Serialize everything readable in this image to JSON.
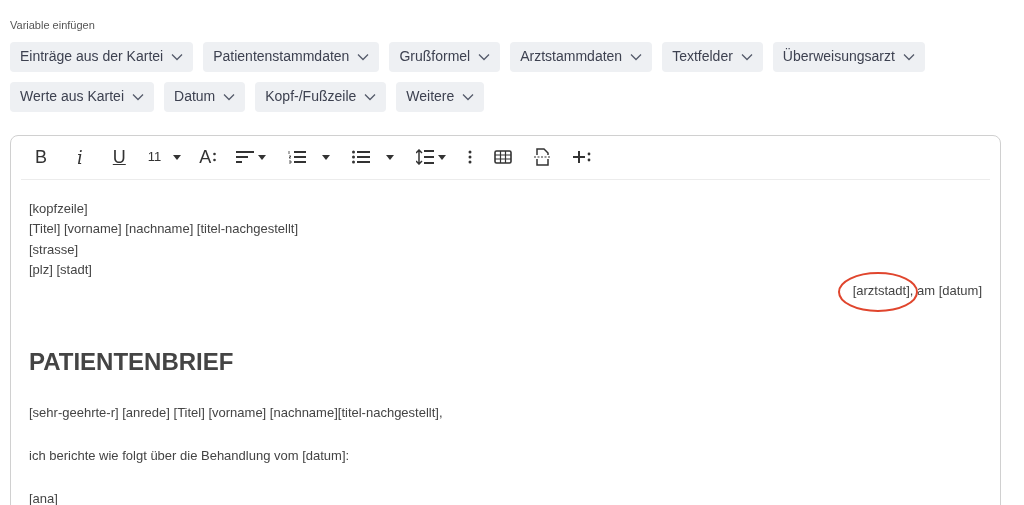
{
  "variables": {
    "label": "Variable einfügen",
    "buttons": [
      "Einträge aus der Kartei",
      "Patientenstammdaten",
      "Grußformel",
      "Arztstammdaten",
      "Textfelder",
      "Überweisungsarzt",
      "Werte aus Kartei",
      "Datum",
      "Kopf-/Fußzeile",
      "Weitere"
    ]
  },
  "toolbar": [
    {
      "kind": "bold",
      "label": "B"
    },
    {
      "kind": "italic",
      "label": "i"
    },
    {
      "kind": "underline",
      "label": "U"
    },
    {
      "kind": "fontsize",
      "label": "11"
    },
    {
      "kind": "format",
      "label": "A"
    },
    {
      "kind": "align"
    },
    {
      "kind": "numbered"
    },
    {
      "kind": "bullets"
    },
    {
      "kind": "lineheight"
    },
    {
      "kind": "more"
    },
    {
      "kind": "table"
    },
    {
      "kind": "pagebreak"
    },
    {
      "kind": "insert"
    }
  ],
  "document": [
    {
      "kind": "line",
      "text": "[kopfzeile]"
    },
    {
      "kind": "line",
      "text": "[Titel] [vorname] [nachname] [titel-nachgestellt]"
    },
    {
      "kind": "line",
      "text": "[strasse]"
    },
    {
      "kind": "line",
      "text": "[plz] [stadt]"
    },
    {
      "kind": "right",
      "text": "[arztstadt], am [datum]"
    },
    {
      "kind": "heading",
      "text": "PATIENTENBRIEF"
    },
    {
      "kind": "paragraph",
      "text": "[sehr-geehrte-r] [anrede] [Titel] [vorname] [nachname][titel-nachgestellt],"
    },
    {
      "kind": "paragraph",
      "text": "ich berichte wie folgt über die Behandlung vom [datum]:"
    },
    {
      "kind": "paragraph",
      "text": "[ana]"
    }
  ]
}
